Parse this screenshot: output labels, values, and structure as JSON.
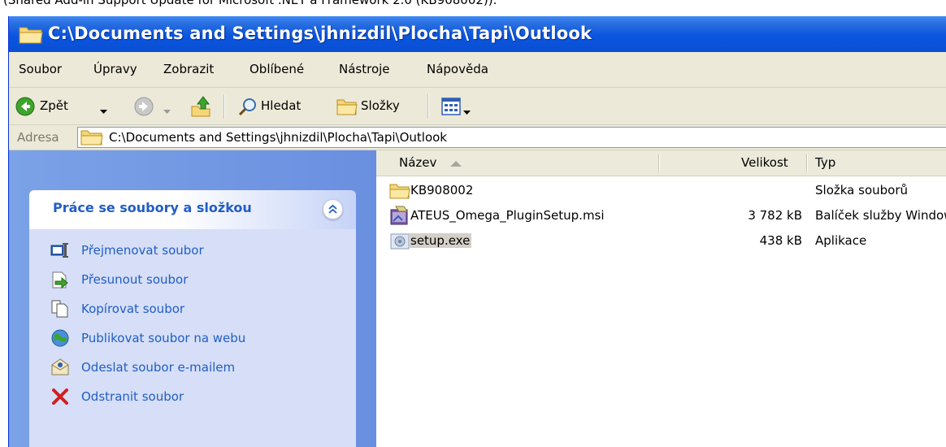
{
  "caption": "(Shared Add-in Support Update for Microsoft .NET a Framework 2.0 (KB908002)).",
  "window": {
    "title": "C:\\Documents and Settings\\jhnizdil\\Plocha\\Tapi\\Outlook"
  },
  "menu": [
    "Soubor",
    "Úpravy",
    "Zobrazit",
    "Oblíbené",
    "Nástroje",
    "Nápověda"
  ],
  "toolbar": {
    "back_label": "Zpět",
    "search_label": "Hledat",
    "folders_label": "Složky"
  },
  "address": {
    "label": "Adresa",
    "value": "C:\\Documents and Settings\\jhnizdil\\Plocha\\Tapi\\Outlook"
  },
  "taskpane": {
    "title": "Práce se soubory a složkou",
    "tasks": [
      {
        "label": "Přejmenovat soubor",
        "icon": "rename-icon"
      },
      {
        "label": "Přesunout soubor",
        "icon": "move-icon"
      },
      {
        "label": "Kopírovat soubor",
        "icon": "copy-icon"
      },
      {
        "label": "Publikovat soubor na webu",
        "icon": "publish-web-icon"
      },
      {
        "label": "Odeslat soubor e-mailem",
        "icon": "email-icon"
      },
      {
        "label": "Odstranit soubor",
        "icon": "delete-icon"
      }
    ]
  },
  "columns": {
    "name": "Název",
    "size": "Velikost",
    "type": "Typ"
  },
  "files": [
    {
      "name": "KB908002",
      "size": "",
      "type": "Složka souborů",
      "icon": "folder-icon"
    },
    {
      "name": "ATEUS_Omega_PluginSetup.msi",
      "size": "3 782 kB",
      "type": "Balíček služby Windows Installer",
      "icon": "msi-icon"
    },
    {
      "name": "setup.exe",
      "size": "438 kB",
      "type": "Aplikace",
      "icon": "exe-icon"
    }
  ],
  "colors": {
    "titlebar": "#0a55df",
    "taskpane": "#7ba2e7",
    "task_link": "#215dc6",
    "chrome": "#ece9d8"
  }
}
